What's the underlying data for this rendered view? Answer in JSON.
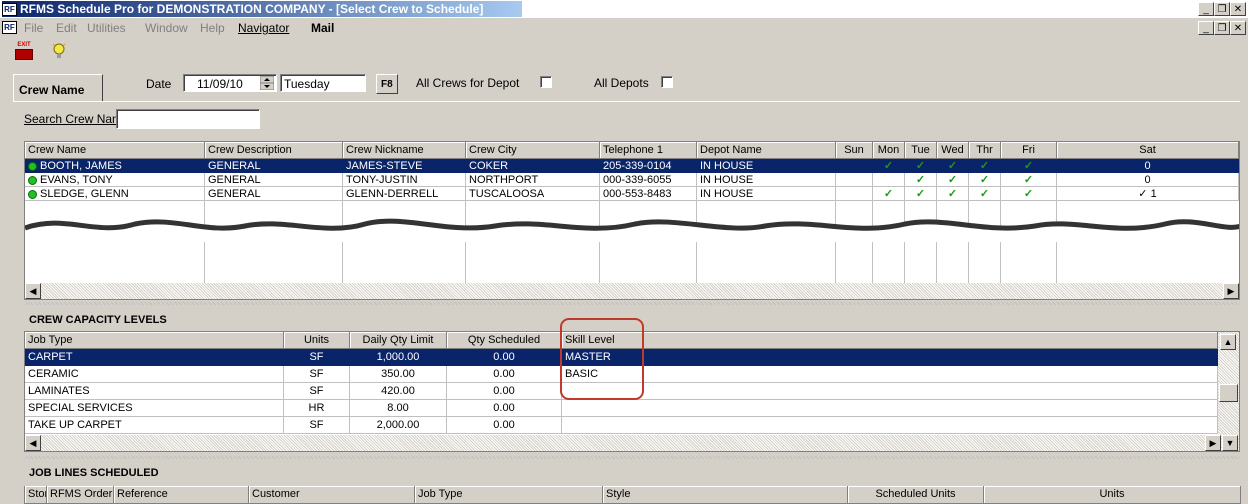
{
  "window": {
    "title": "RFMS Schedule Pro for DEMONSTRATION COMPANY - [Select Crew to Schedule]",
    "title_controls": [
      "_",
      "❐",
      "✕"
    ],
    "mdi_controls": [
      "_",
      "❐",
      "✕"
    ]
  },
  "menu": {
    "items": [
      "File",
      "Edit",
      "Utilities",
      "Window",
      "Help",
      "Navigator",
      "Mail"
    ]
  },
  "toolbar": {
    "exit_label": "EXIT"
  },
  "filters": {
    "tab_label": "Crew Name",
    "date_label": "Date",
    "date_value": "11/09/10",
    "day_value": "Tuesday",
    "f8_label": "F8",
    "all_crews_label": "All Crews for Depot",
    "all_depots_label": "All Depots",
    "search_label": "Search Crew Name",
    "search_value": ""
  },
  "crews": {
    "headers": [
      "Crew Name",
      "Crew Description",
      "Crew Nickname",
      "Crew City",
      "Telephone 1",
      "Depot Name",
      "Sun",
      "Mon",
      "Tue",
      "Wed",
      "Thr",
      "Fri",
      "Sat"
    ],
    "rows": [
      {
        "name": "BOOTH, JAMES",
        "desc": "GENERAL",
        "nick": "JAMES-STEVE",
        "city": "COKER",
        "phone": "205-339-0104",
        "depot": "IN HOUSE",
        "sun": "",
        "mon": "✓",
        "tue": "✓",
        "wed": "✓",
        "thr": "✓",
        "fri": "✓",
        "sat": "0"
      },
      {
        "name": "EVANS, TONY",
        "desc": "GENERAL",
        "nick": "TONY-JUSTIN",
        "city": "NORTHPORT",
        "phone": "000-339-6055",
        "depot": "IN HOUSE",
        "sun": "",
        "mon": "",
        "tue": "✓",
        "wed": "✓",
        "thr": "✓",
        "fri": "✓",
        "sat": "0"
      },
      {
        "name": "SLEDGE, GLENN",
        "desc": "GENERAL",
        "nick": "GLENN-DERRELL",
        "city": "TUSCALOOSA",
        "phone": "000-553-8483",
        "depot": "IN HOUSE",
        "sun": "",
        "mon": "✓",
        "tue": "✓",
        "wed": "✓",
        "thr": "✓",
        "fri": "✓",
        "sat": "✓  1"
      }
    ]
  },
  "capacity": {
    "title": "CREW CAPACITY LEVELS",
    "headers": [
      "Job Type",
      "Units",
      "Daily Qty Limit",
      "Qty Scheduled",
      "Skill Level"
    ],
    "rows": [
      {
        "job": "CARPET",
        "units": "SF",
        "limit": "1,000.00",
        "sched": "0.00",
        "skill": "MASTER"
      },
      {
        "job": "CERAMIC",
        "units": "SF",
        "limit": "350.00",
        "sched": "0.00",
        "skill": "BASIC"
      },
      {
        "job": "LAMINATES",
        "units": "SF",
        "limit": "420.00",
        "sched": "0.00",
        "skill": ""
      },
      {
        "job": "SPECIAL SERVICES",
        "units": "HR",
        "limit": "8.00",
        "sched": "0.00",
        "skill": ""
      },
      {
        "job": "TAKE UP CARPET",
        "units": "SF",
        "limit": "2,000.00",
        "sched": "0.00",
        "skill": ""
      }
    ]
  },
  "job_lines": {
    "title": "JOB LINES SCHEDULED",
    "headers": [
      "Store",
      "RFMS Order #",
      "Reference",
      "Customer",
      "Job Type",
      "Style",
      "Scheduled Units",
      "Units"
    ]
  },
  "colors": {
    "selection": "#0a246a",
    "check": "#1a9a1a",
    "highlight_box": "#c0392b"
  }
}
